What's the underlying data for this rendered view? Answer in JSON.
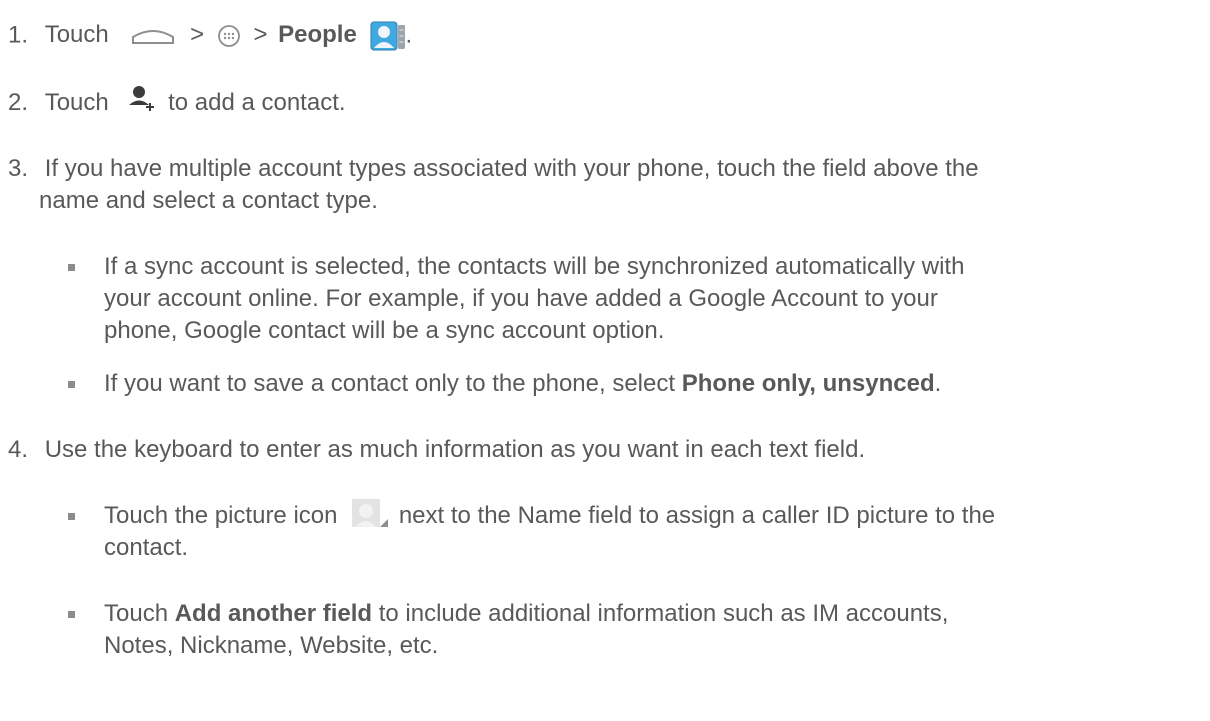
{
  "steps": [
    {
      "number": "1.",
      "text_touch": "Touch",
      "sep1": ">",
      "sep2": ">",
      "bold": "People",
      "end": ".",
      "icons": [
        "home-icon",
        "apps-icon",
        "people-app-icon"
      ]
    },
    {
      "number": "2.",
      "text_before": "Touch",
      "text_after": "to add a contact.",
      "icons": [
        "add-contact-icon"
      ]
    },
    {
      "number": "3.",
      "line1": "If you have multiple account types associated with your phone, touch the field above the",
      "line2": "name and select a contact type.",
      "bullets": [
        {
          "line1": "If a sync account is selected, the contacts will be synchronized automatically with",
          "line2": "your account online. For example, if you have added a Google Account to your",
          "line3": "phone, Google contact will be a sync account option."
        },
        {
          "text_before": "If you want to save a contact only to the phone, select",
          "bold": "Phone only, unsynced",
          "end": "."
        }
      ]
    },
    {
      "number": "4.",
      "line1": "Use the keyboard to enter as much information as you want in each text field.",
      "bullets": [
        {
          "text_before": "Touch the picture icon",
          "text_after": "next to the Name field to assign a caller ID picture to the",
          "line2": "contact.",
          "icons": [
            "contact-picture-icon"
          ]
        },
        {
          "text_before": "Touch",
          "bold": "Add another field",
          "text_after": "to include additional information such as IM accounts,",
          "line2": "Notes, Nickname, Website, etc."
        }
      ]
    }
  ]
}
